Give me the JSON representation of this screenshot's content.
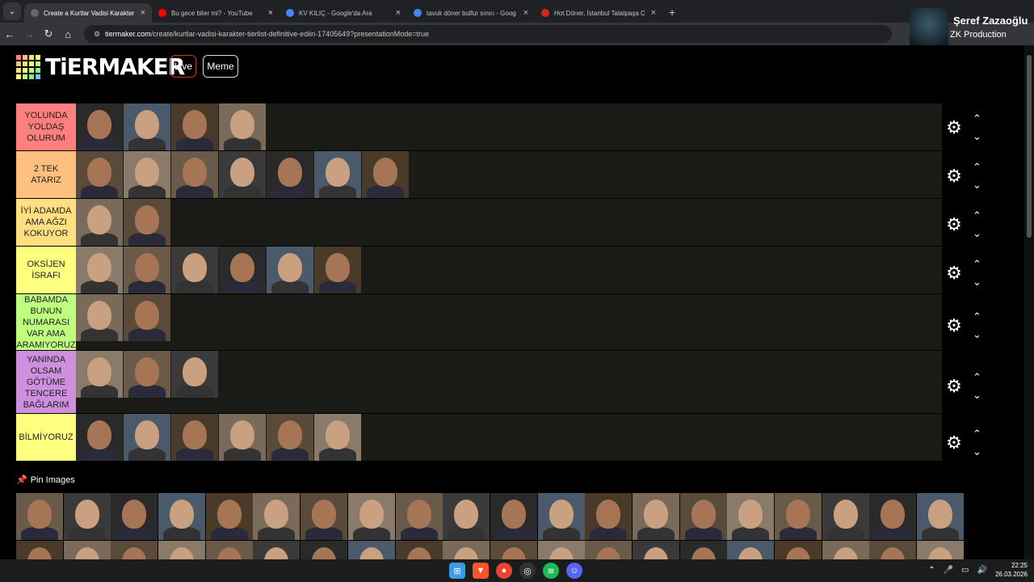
{
  "browser": {
    "tabs": [
      {
        "title": "Create a Kurtlar Vadisi Karakter",
        "active": true,
        "favicon_color": "#666666"
      },
      {
        "title": "Bu gece biter mi? - YouTube",
        "active": false,
        "favicon_color": "#ff0000"
      },
      {
        "title": "KV KILIÇ - Google'da Ara",
        "active": false,
        "favicon_color": "#4285f4"
      },
      {
        "title": "tavuk döner bulfur sınırı - Goog",
        "active": false,
        "favicon_color": "#4285f4"
      },
      {
        "title": "Hot Döner, İstanbul Talatpaşa C",
        "active": false,
        "favicon_color": "#d32323"
      }
    ],
    "url_host": "tiermaker.com",
    "url_path": "/create/kurtlar-vadisi-karakter-tierlist-definitive-ediin-17405649?presentationMode=true",
    "profile_name": "Şeref Zazaoğlu",
    "profile_sub": "ZK Production"
  },
  "site": {
    "logo_text": "TiERMAKER",
    "live_label": "Live",
    "meme_label": "Meme"
  },
  "tiers": [
    {
      "label": "YOLUNDA YOLDAŞ OLURUM",
      "color": "#ff7f7f",
      "count": 4,
      "height": 59
    },
    {
      "label": "2 TEK ATARIZ",
      "color": "#ffbf7f",
      "count": 7,
      "height": 59
    },
    {
      "label": "İYİ ADAMDA AMA AĞZI KOKUYOR",
      "color": "#ffdf7f",
      "count": 2,
      "height": 59
    },
    {
      "label": "OKSİJEN İSRAFI",
      "color": "#ffff7f",
      "count": 6,
      "height": 59
    },
    {
      "label": "BABAMDA BUNUN NUMARASI VAR AMA ARAMIYORUZ",
      "color": "#bfff7f",
      "count": 2,
      "height": 70
    },
    {
      "label": "YANINDA OLSAM GÖTÜME TENCERE BAĞLARIM",
      "color": "#cf8fdf",
      "count": 3,
      "height": 78
    },
    {
      "label": "BİLMİYORUZ",
      "color": "#ffff7f",
      "count": 6,
      "height": 59
    }
  ],
  "pin_label": "Pin Images",
  "pool_count": 40,
  "taskbar": {
    "time": "22:25",
    "date": "26.03.2026"
  }
}
